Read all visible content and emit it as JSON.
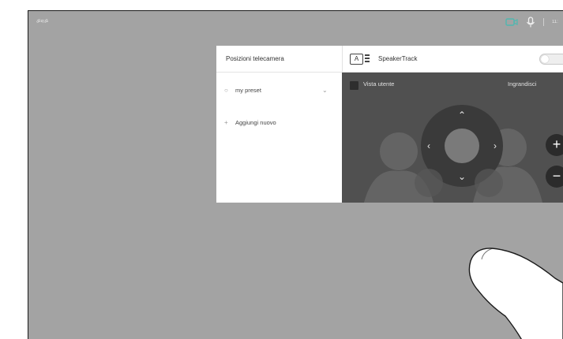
{
  "status_bar": {
    "left_text": "ॐमॐ",
    "time_text": "11:",
    "colors": {
      "camera": "#4fb7b0",
      "mic": "#f0f0f0"
    },
    "icons": [
      "camera-icon",
      "mic-icon"
    ]
  },
  "camera_panel": {
    "title": "Posizioni telecamera",
    "presets": [
      {
        "label": "my preset",
        "bullet": "○",
        "expand": "⌄"
      },
      {
        "label": "Aggiungi nuovo",
        "bullet": "+"
      }
    ],
    "speaker_track_label": "SpeakerTrack",
    "auto_icon_text": "A",
    "speaker_track_enabled": false
  },
  "video": {
    "self_view_label": "Vista utente",
    "zoom_label": "Ingrandisci",
    "zoom_in_symbol": "+",
    "zoom_out_symbol": "−",
    "arrows": {
      "up": "⌃",
      "down": "⌄",
      "left": "‹",
      "right": "›"
    }
  }
}
